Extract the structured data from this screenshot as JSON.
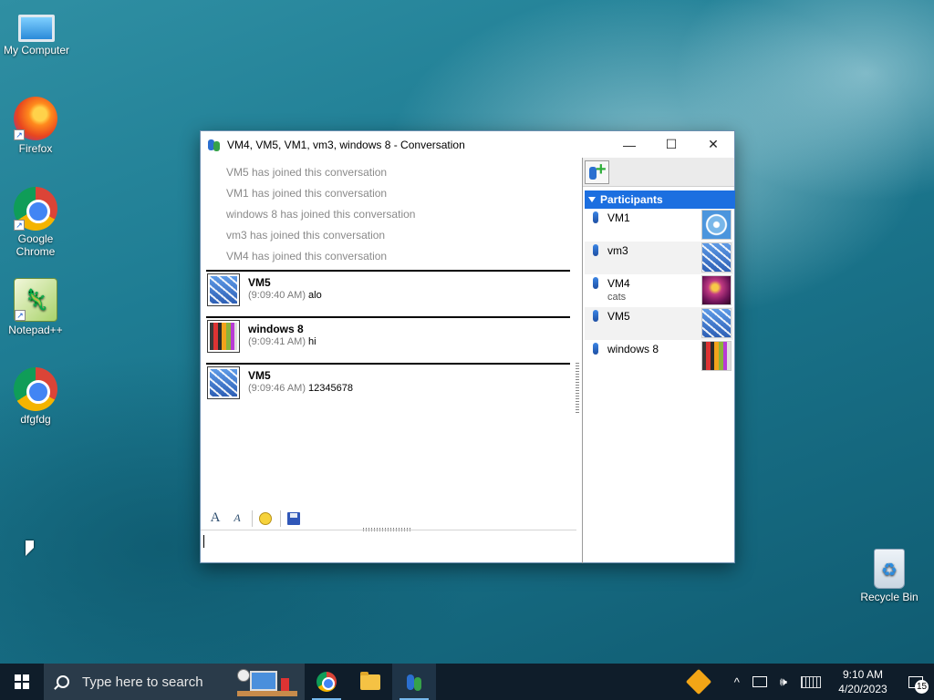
{
  "desktop": {
    "icons": [
      {
        "label": "My Computer"
      },
      {
        "label": "Firefox"
      },
      {
        "label": "Google Chrome"
      },
      {
        "label": "Notepad++"
      },
      {
        "label": "dfgfdg"
      },
      {
        "label": "Recycle Bin"
      }
    ]
  },
  "window": {
    "title": "VM4, VM5, VM1, vm3, windows 8 - Conversation",
    "controls": {
      "minimize": "—",
      "maximize": "☐",
      "close": "✕"
    },
    "system_messages": [
      "VM5 has joined this conversation",
      "VM1 has joined this conversation",
      "windows 8 has joined this conversation",
      "vm3 has joined this conversation",
      "VM4 has joined this conversation"
    ],
    "messages": [
      {
        "sender": "VM5",
        "time": "(9:09:40 AM)",
        "text": "alo"
      },
      {
        "sender": "windows 8",
        "time": "(9:09:41 AM)",
        "text": "hi"
      },
      {
        "sender": "VM5",
        "time": "(9:09:46 AM)",
        "text": "12345678"
      }
    ],
    "format_toolbar": {
      "font": "A",
      "font_style": "A"
    },
    "input": {
      "value": ""
    },
    "participants": {
      "header": "Participants",
      "list": [
        {
          "name": "VM1",
          "status": ""
        },
        {
          "name": "vm3",
          "status": ""
        },
        {
          "name": "VM4",
          "status": "cats"
        },
        {
          "name": "VM5",
          "status": ""
        },
        {
          "name": "windows 8",
          "status": ""
        }
      ]
    }
  },
  "taskbar": {
    "search_placeholder": "Type here to search",
    "tray": {
      "chevron": "^",
      "volume": "🕪"
    },
    "clock": {
      "time": "9:10 AM",
      "date": "4/20/2023"
    },
    "notification_count": "15"
  }
}
